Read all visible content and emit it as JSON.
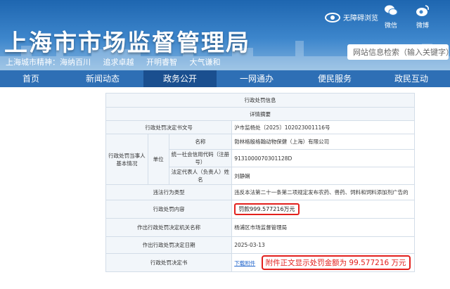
{
  "header": {
    "title": "上海市市场监督管理局",
    "slogan": [
      "上海城市精神：海纳百川",
      "追求卓越",
      "开明睿智",
      "大气谦和"
    ],
    "barrier_free": "无障碍浏览",
    "wechat": "微信",
    "weibo": "微博",
    "search_placeholder": "网站信息检索（输入关键字）"
  },
  "nav": [
    "首页",
    "新闻动态",
    "政务公开",
    "一网通办",
    "便民服务",
    "政民互动"
  ],
  "table": {
    "title": "行政处罚信息",
    "subtitle": "详情摘要",
    "doc_no_label": "行政处罚决定书文号",
    "doc_no": "沪市监杨处〔2025〕102023001116号",
    "party_label": "行政处罚当事人基本情况",
    "unit_label": "单位",
    "name_label": "名称",
    "name_value": "勃林格殷格翰动物保健（上海）有限公司",
    "credit_label": "统一社会信用代码（注册号）",
    "credit_value": "9131000070301128D",
    "rep_label": "法定代表人（负责人）姓名",
    "rep_value": "刘静娴",
    "violation_label": "违法行为类型",
    "violation_value": "违反本法第二十一条第二项规定发布农药、兽药、饲料和饲料添加剂广告的",
    "content_label": "行政处罚内容",
    "content_value": "罚款999.577216万元",
    "organ_label": "作出行政处罚决定机关名称",
    "organ_value": "杨浦区市场监督管理局",
    "date_label": "作出行政处罚决定日期",
    "date_value": "2025-03-13",
    "doc_label": "行政处罚决定书",
    "doc_link": "下载附件",
    "note": "附件正文显示处罚金额为 99.577216 万元"
  },
  "colors": {
    "nav": "#2e6fb5",
    "nav_active": "#1a4f8f",
    "highlight": "#e2201d"
  }
}
